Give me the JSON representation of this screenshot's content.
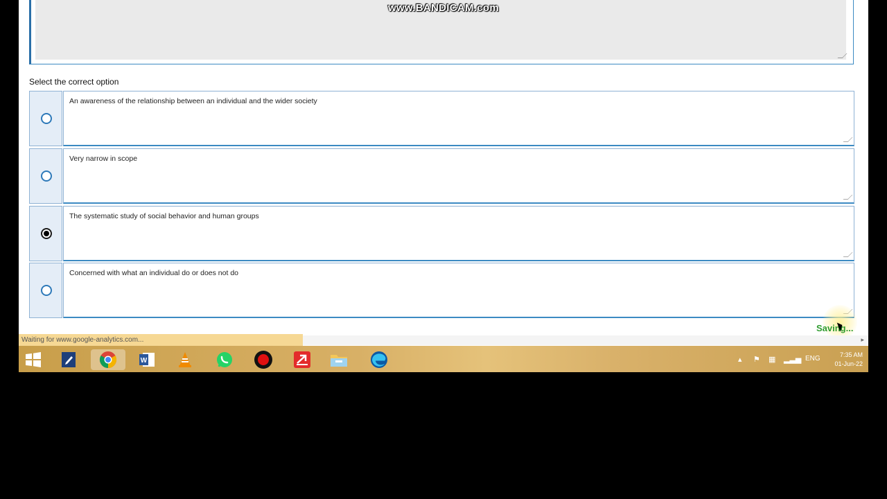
{
  "watermark": "www.BANDICAM.com",
  "question": {
    "prompt_label": "Select the correct option"
  },
  "options": [
    {
      "text": "An awareness of the relationship between an individual and the wider society",
      "selected": false
    },
    {
      "text": "Very narrow in scope",
      "selected": false
    },
    {
      "text": "The systematic study of social behavior and human groups",
      "selected": true
    },
    {
      "text": "Concerned with what an individual do or does not do",
      "selected": false
    }
  ],
  "saving_label": "Saving...",
  "browser": {
    "status_text": "Waiting for www.google-analytics.com..."
  },
  "taskbar": {
    "apps": [
      "start",
      "notepad",
      "chrome",
      "word",
      "vlc",
      "whatsapp",
      "bandicam",
      "pdf-reader",
      "file-explorer",
      "edge"
    ],
    "tray": {
      "language": "ENG",
      "time": "7:35 AM",
      "date": "01-Jun-22"
    }
  }
}
